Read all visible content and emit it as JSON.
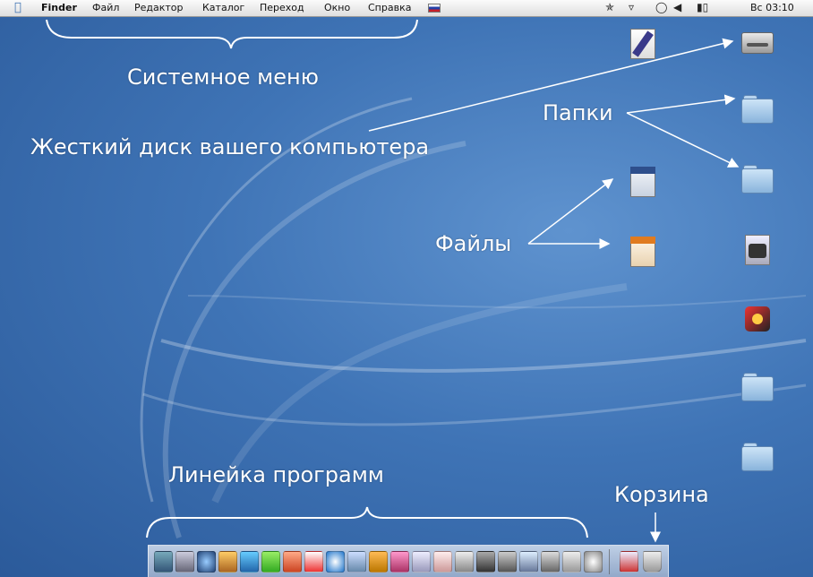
{
  "menubar": {
    "app_name": "Finder",
    "items": [
      "Файл",
      "Редактор",
      "Каталог",
      "Переход",
      "Окно",
      "Справка"
    ],
    "clock": "Вс 03:10",
    "icons": [
      "apple-icon",
      "russian-flag-icon",
      "script-icon",
      "wifi-icon",
      "sync-icon",
      "volume-icon",
      "battery-icon"
    ]
  },
  "annotations": {
    "system_menu": "Системное меню",
    "hard_disk": "Жесткий диск вашего компьютера",
    "folders": "Папки",
    "files": "Файлы",
    "dock": "Линейка программ",
    "trash": "Корзина"
  },
  "desktop_icons": [
    {
      "type": "document-pen-icon"
    },
    {
      "type": "hard-disk-icon"
    },
    {
      "type": "folder-icon"
    },
    {
      "type": "text-file-icon"
    },
    {
      "type": "folder-icon"
    },
    {
      "type": "presentation-file-icon"
    },
    {
      "type": "installer-icon"
    },
    {
      "type": "application-icon"
    },
    {
      "type": "folder-icon"
    },
    {
      "type": "folder-icon"
    }
  ],
  "colors": {
    "desktop": "#3f74b6",
    "menubar": "#efefef",
    "annotation_text": "#ffffff"
  }
}
